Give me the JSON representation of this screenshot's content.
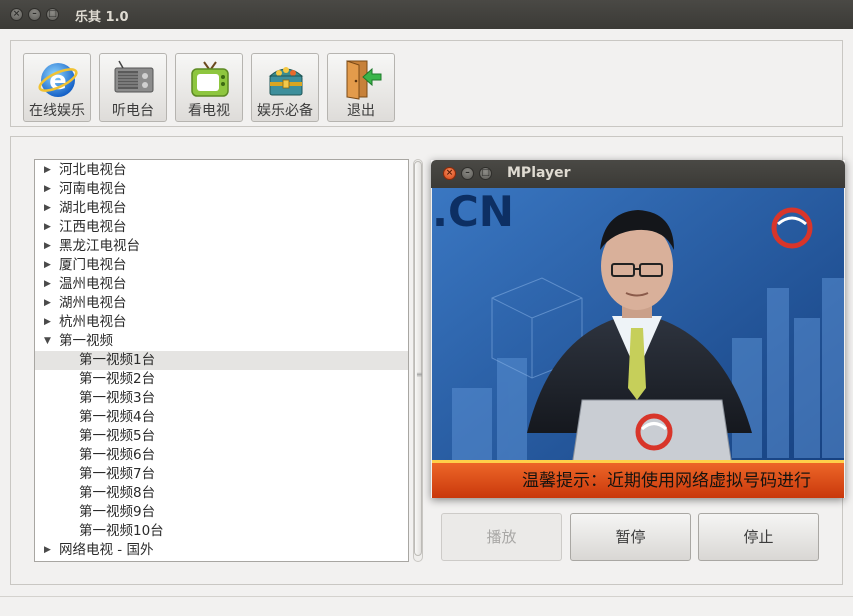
{
  "window": {
    "title": "乐其 1.0"
  },
  "toolbar": {
    "buttons": [
      {
        "label": "在线娱乐",
        "icon": "ie-globe-icon"
      },
      {
        "label": "听电台",
        "icon": "radio-icon"
      },
      {
        "label": "看电视",
        "icon": "tv-icon"
      },
      {
        "label": "娱乐必备",
        "icon": "treasure-chest-icon"
      },
      {
        "label": "退出",
        "icon": "exit-door-icon"
      }
    ]
  },
  "tree": {
    "items": [
      {
        "label": "河北电视台",
        "expandable": true,
        "expanded": false,
        "level": 0
      },
      {
        "label": "河南电视台",
        "expandable": true,
        "expanded": false,
        "level": 0
      },
      {
        "label": "湖北电视台",
        "expandable": true,
        "expanded": false,
        "level": 0
      },
      {
        "label": "江西电视台",
        "expandable": true,
        "expanded": false,
        "level": 0
      },
      {
        "label": "黑龙江电视台",
        "expandable": true,
        "expanded": false,
        "level": 0
      },
      {
        "label": "厦门电视台",
        "expandable": true,
        "expanded": false,
        "level": 0
      },
      {
        "label": "温州电视台",
        "expandable": true,
        "expanded": false,
        "level": 0
      },
      {
        "label": "湖州电视台",
        "expandable": true,
        "expanded": false,
        "level": 0
      },
      {
        "label": "杭州电视台",
        "expandable": true,
        "expanded": false,
        "level": 0
      },
      {
        "label": "第一视频",
        "expandable": true,
        "expanded": true,
        "level": 0
      },
      {
        "label": "第一视频1台",
        "level": 1,
        "selected": true
      },
      {
        "label": "第一视频2台",
        "level": 1
      },
      {
        "label": "第一视频3台",
        "level": 1
      },
      {
        "label": "第一视频4台",
        "level": 1
      },
      {
        "label": "第一视频5台",
        "level": 1
      },
      {
        "label": "第一视频6台",
        "level": 1
      },
      {
        "label": "第一视频7台",
        "level": 1
      },
      {
        "label": "第一视频8台",
        "level": 1
      },
      {
        "label": "第一视频9台",
        "level": 1
      },
      {
        "label": "第一视频10台",
        "level": 1
      },
      {
        "label": "网络电视 - 国外",
        "expandable": true,
        "expanded": false,
        "level": 0
      }
    ]
  },
  "controls": {
    "play_label": "播放",
    "pause_label": "暂停",
    "stop_label": "停止"
  },
  "mplayer": {
    "title": "MPlayer",
    "video": {
      "logo_text": ".CN",
      "ticker_text": "温馨提示：近期使用网络虚拟号码进行"
    }
  },
  "colors": {
    "titlebar": "#3c3b37",
    "background": "#f2f1f0",
    "video_blue": "#1b4f96",
    "ticker_orange": "#e8531a"
  }
}
